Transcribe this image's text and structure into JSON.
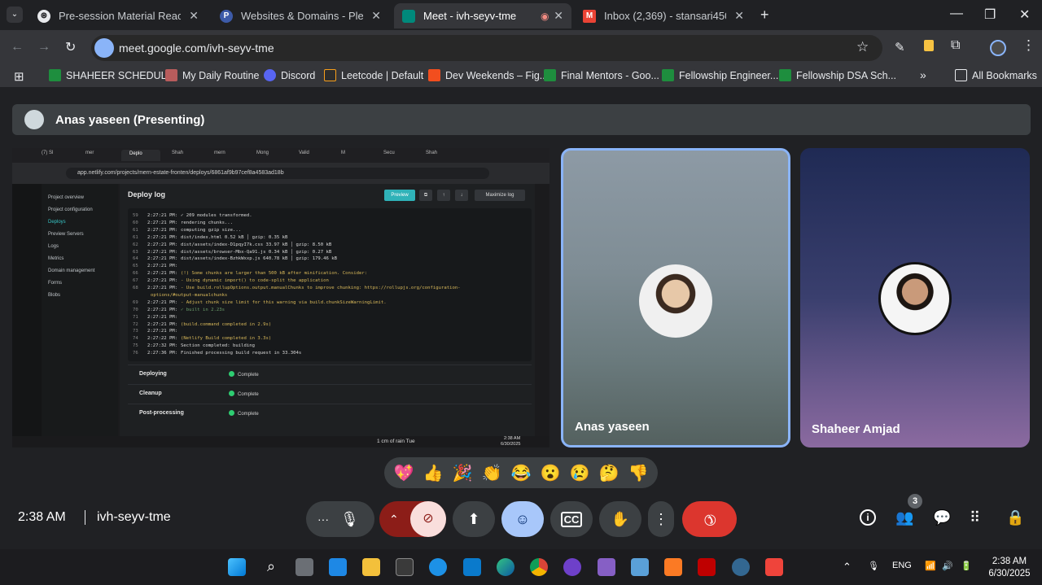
{
  "browser": {
    "tabs": [
      {
        "title": "Pre-session Material React Desi",
        "active": false
      },
      {
        "title": "Websites & Domains - Plesk Ob",
        "active": false
      },
      {
        "title": "Meet - ivh-seyv-tme",
        "active": true
      },
      {
        "title": "Inbox (2,369) - stansari4500@g",
        "active": false
      }
    ],
    "url": "meet.google.com/ivh-seyv-tme",
    "bookmarks": [
      "SHAHEER SCHEDUL...",
      "My Daily Routine",
      "Discord",
      "Leetcode | Default",
      "Dev Weekends – Fig...",
      "Final Mentors - Goo...",
      "Fellowship Engineer...",
      "Fellowship DSA Sch..."
    ],
    "all_bookmarks": "All Bookmarks"
  },
  "meet": {
    "presenting_label": "Anas yaseen (Presenting)",
    "participants": [
      {
        "name": "Anas yaseen",
        "speaking": true
      },
      {
        "name": "Shaheer Amjad",
        "speaking": false
      }
    ],
    "reactions": [
      "💖",
      "👍",
      "🎉",
      "👏",
      "😂",
      "😮",
      "😢",
      "🤔",
      "👎"
    ],
    "time": "2:38 AM",
    "meeting_code": "ivh-seyv-tme",
    "participant_count": "3"
  },
  "shared_screen": {
    "url": "app.netlify.com/projects/mern-estate-fronten/deploys/6861af9b97cef8a4583ad18b",
    "tabs": [
      "(7) Sl",
      "mer",
      "Deplo",
      "Shah",
      "mern",
      "Mong",
      "Valid",
      "M",
      "Secu",
      "Shah"
    ],
    "nav": [
      "Project overview",
      "Project configuration",
      "Deploys",
      "Preview Servers",
      "Logs",
      "Metrics",
      "Domain management",
      "Forms",
      "Blobs"
    ],
    "title": "Deploy log",
    "preview_label": "Preview",
    "maximize_label": "Maximize log",
    "log_lines": [
      {
        "n": "59",
        "t": "2:27:21 PM:",
        "m": "✓ 209 modules transformed.",
        "c": ""
      },
      {
        "n": "60",
        "t": "2:27:21 PM:",
        "m": "rendering chunks...",
        "c": ""
      },
      {
        "n": "61",
        "t": "2:27:21 PM:",
        "m": "computing gzip size...",
        "c": ""
      },
      {
        "n": "61",
        "t": "2:27:21 PM:",
        "m": "dist/index.html                   0.52 kB │ gzip:   0.35 kB",
        "c": ""
      },
      {
        "n": "62",
        "t": "2:27:21 PM:",
        "m": "dist/assets/index-D1pqyI7k.css   33.97 kB │ gzip:   8.50 kB",
        "c": ""
      },
      {
        "n": "63",
        "t": "2:27:21 PM:",
        "m": "dist/assets/browser-Mbx-Qa91.js   0.34 kB │ gzip:   0.27 kB",
        "c": ""
      },
      {
        "n": "64",
        "t": "2:27:21 PM:",
        "m": "dist/assets/index-BzhkWxxp.js   640.78 kB │ gzip: 179.46 kB",
        "c": ""
      },
      {
        "n": "65",
        "t": "2:27:21 PM:",
        "m": "",
        "c": ""
      },
      {
        "n": "66",
        "t": "2:27:21 PM:",
        "m": "(!) Some chunks are larger than 500 kB after minification. Consider:",
        "c": "y"
      },
      {
        "n": "67",
        "t": "2:27:21 PM:",
        "m": "- Using dynamic import() to code-split the application",
        "c": "y"
      },
      {
        "n": "68",
        "t": "2:27:21 PM:",
        "m": "- Use build.rollupOptions.output.manualChunks to improve chunking: https://rollupjs.org/configuration-",
        "c": "y"
      },
      {
        "n": "",
        "t": "",
        "m": "options/#output-manualchunks",
        "c": "y"
      },
      {
        "n": "69",
        "t": "2:27:21 PM:",
        "m": "- Adjust chunk size limit for this warning via build.chunkSizeWarningLimit.",
        "c": "y"
      },
      {
        "n": "70",
        "t": "2:27:21 PM:",
        "m": "✓ built in 2.23s",
        "c": "g"
      },
      {
        "n": "71",
        "t": "2:27:21 PM:",
        "m": "",
        "c": ""
      },
      {
        "n": "72",
        "t": "2:27:21 PM:",
        "m": "(build.command completed in 2.9s)",
        "c": "y"
      },
      {
        "n": "73",
        "t": "2:27:21 PM:",
        "m": "",
        "c": ""
      },
      {
        "n": "74",
        "t": "2:27:22 PM:",
        "m": "(Netlify Build completed in 3.3s)",
        "c": "y"
      },
      {
        "n": "75",
        "t": "2:27:32 PM:",
        "m": "Section completed: building",
        "c": ""
      },
      {
        "n": "76",
        "t": "2:27:36 PM:",
        "m": "Finished processing build request in 33.304s",
        "c": ""
      }
    ],
    "stages": [
      {
        "label": "Deploying",
        "status": "Complete"
      },
      {
        "label": "Cleanup",
        "status": "Complete"
      },
      {
        "label": "Post-processing",
        "status": "Complete"
      }
    ],
    "weather": "1 cm of rain Tue",
    "time": "2:38 AM",
    "date": "6/30/2025"
  },
  "taskbar": {
    "language": "ENG",
    "time": "2:38 AM",
    "date": "6/30/2025"
  }
}
